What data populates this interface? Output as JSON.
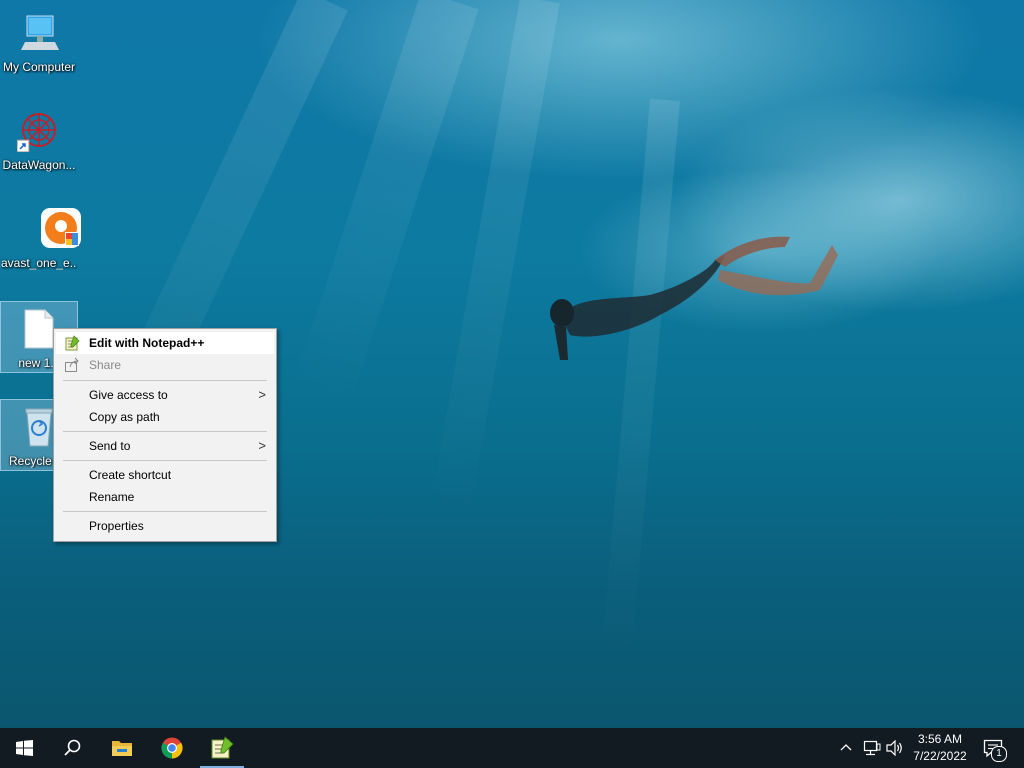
{
  "desktop": {
    "icons": [
      {
        "label": "My Computer"
      },
      {
        "label": "DataWagon..."
      },
      {
        "label": "avast_one_e..."
      },
      {
        "label": "new 1.c"
      },
      {
        "label": "Recycle"
      }
    ]
  },
  "context_menu": {
    "items": [
      {
        "label": "Edit with Notepad++",
        "icon": "notepad-plus-plus-icon"
      },
      {
        "label": "Share",
        "icon": "share-icon",
        "disabled": true
      },
      {
        "label": "Give access to",
        "submenu": true
      },
      {
        "label": "Copy as path"
      },
      {
        "label": "Send to",
        "submenu": true
      },
      {
        "label": "Create shortcut"
      },
      {
        "label": "Rename"
      },
      {
        "label": "Properties"
      }
    ],
    "submenu_arrow": ">"
  },
  "taskbar": {
    "pinned": [
      "start-icon",
      "search-icon",
      "file-explorer-icon",
      "chrome-icon",
      "notepad-plus-plus-icon"
    ],
    "clock": {
      "time": "3:56 AM",
      "date": "7/22/2022"
    },
    "tray": [
      "chevron-up-icon",
      "network-icon",
      "volume-icon"
    ],
    "notifications_count": "1"
  },
  "colors": {
    "taskbar": "#121a22",
    "menu_bg": "#f2f2f2",
    "menu_highlight": "#ffffff",
    "selection": "#aad2eb"
  }
}
